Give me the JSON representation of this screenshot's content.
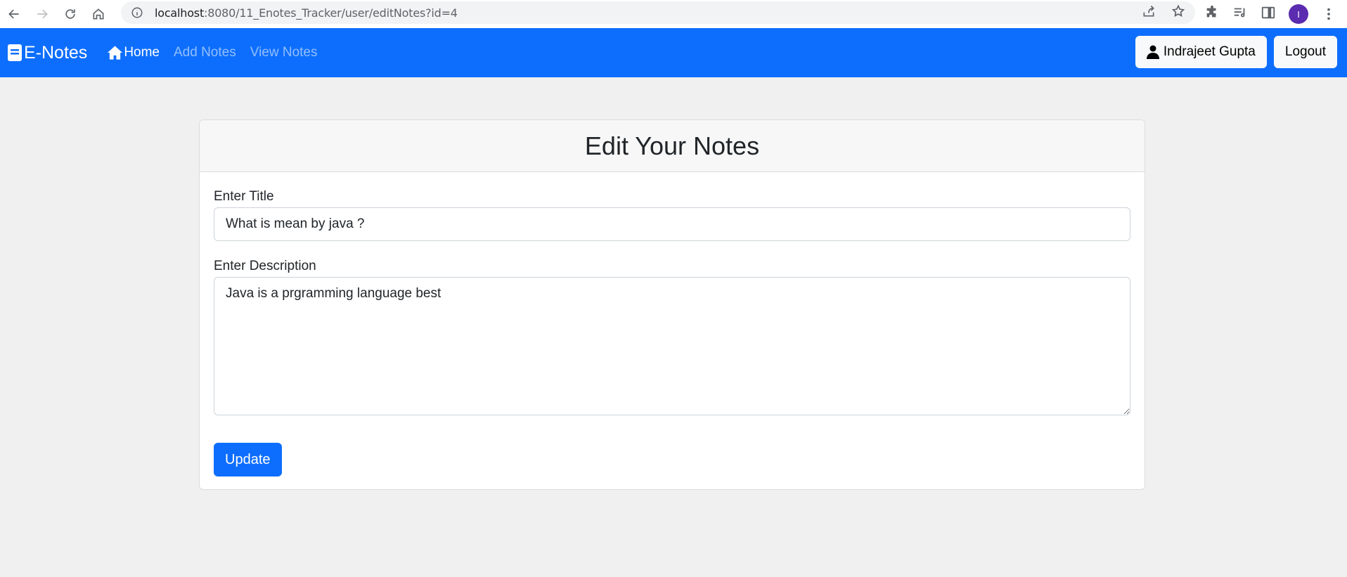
{
  "browser": {
    "url_host": "localhost",
    "url_path": ":8080/11_Enotes_Tracker/user/editNotes?id=4",
    "profile_initial": "I"
  },
  "navbar": {
    "brand": "E-Notes",
    "links": [
      {
        "label": "Home",
        "active": true
      },
      {
        "label": "Add Notes",
        "active": false
      },
      {
        "label": "View Notes",
        "active": false
      }
    ],
    "user_button": "Indrajeet Gupta",
    "logout_button": "Logout",
    "background_color": "#0d6efd"
  },
  "card": {
    "title": "Edit Your Notes",
    "title_label": "Enter Title",
    "title_value": "What is mean by java ?",
    "description_label": "Enter Description",
    "description_value": "Java is a prgramming language best",
    "submit_button": "Update"
  }
}
